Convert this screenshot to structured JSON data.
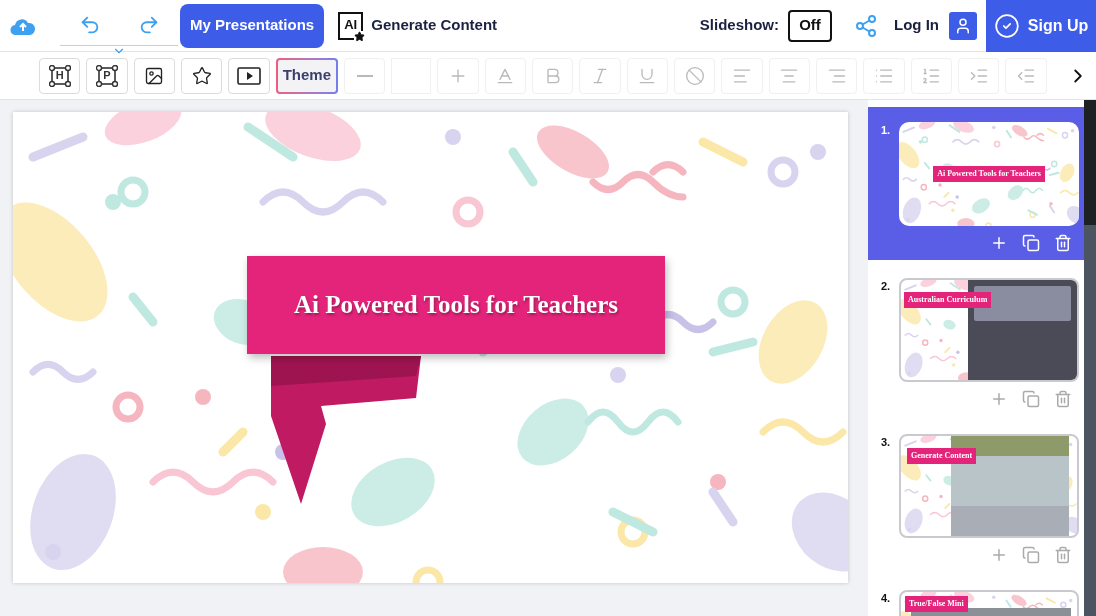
{
  "header": {
    "my_presentations": "My Presentations",
    "ai_badge": "AI",
    "generate": "Generate Content",
    "slideshow_label": "Slideshow:",
    "slideshow_value": "Off",
    "login": "Log In",
    "signup": "Sign Up"
  },
  "toolbar": [
    {
      "kind": "heading",
      "label": "H",
      "disabled": false
    },
    {
      "kind": "paragraph",
      "label": "P",
      "disabled": false
    },
    {
      "kind": "image",
      "disabled": false
    },
    {
      "kind": "star",
      "disabled": false
    },
    {
      "kind": "video",
      "disabled": false
    },
    {
      "kind": "theme",
      "label": "Theme",
      "disabled": false
    },
    {
      "kind": "minus",
      "disabled": true
    },
    {
      "kind": "font-size",
      "disabled": true
    },
    {
      "kind": "plus",
      "disabled": true
    },
    {
      "kind": "color",
      "disabled": true
    },
    {
      "kind": "bold",
      "disabled": true
    },
    {
      "kind": "italic",
      "disabled": true
    },
    {
      "kind": "underline",
      "disabled": true
    },
    {
      "kind": "clear",
      "disabled": true
    },
    {
      "kind": "align-left",
      "disabled": true
    },
    {
      "kind": "align-center",
      "disabled": true
    },
    {
      "kind": "align-right",
      "disabled": true
    },
    {
      "kind": "bullets",
      "disabled": true
    },
    {
      "kind": "numbered",
      "disabled": true
    },
    {
      "kind": "indent",
      "disabled": true
    },
    {
      "kind": "outdent",
      "disabled": true
    },
    {
      "kind": "more",
      "disabled": false
    }
  ],
  "slide": {
    "title": "Ai Powered Tools for Teachers"
  },
  "slides": [
    {
      "number": "1.",
      "title": "Ai Powered Tools for Teachers",
      "kind": "title",
      "selected": true
    },
    {
      "number": "2.",
      "title": "Australian Curriculum",
      "kind": "dark-screenshot",
      "selected": false
    },
    {
      "number": "3.",
      "title": "Generate Content",
      "kind": "forest-screenshot",
      "selected": false
    },
    {
      "number": "4.",
      "title": "True/False Mini",
      "kind": "quiz-screenshot",
      "selected": false
    }
  ]
}
